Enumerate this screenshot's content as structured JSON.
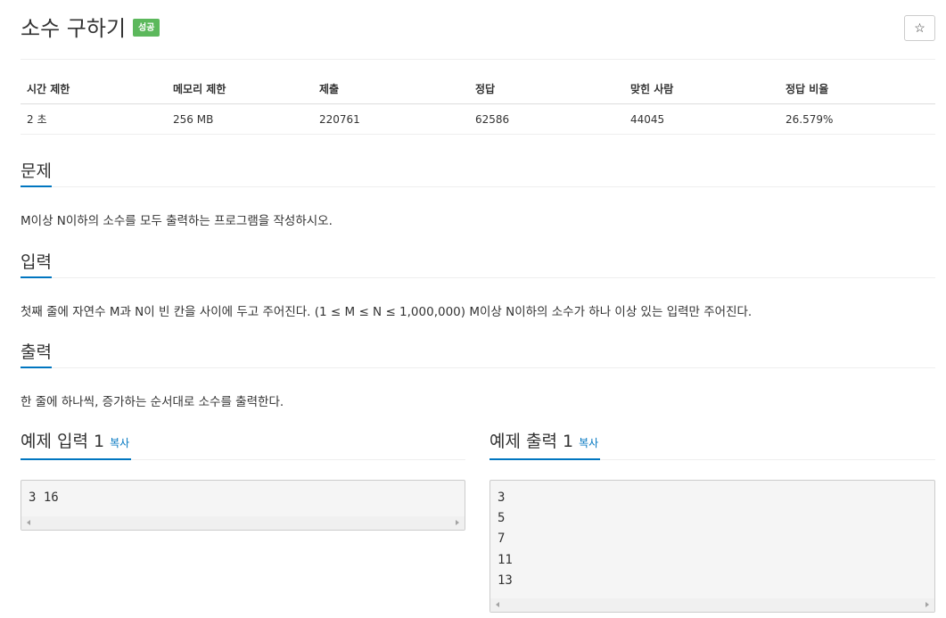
{
  "header": {
    "title": "소수 구하기",
    "badge": "성공",
    "star_icon": "☆"
  },
  "info_table": {
    "headers": [
      "시간 제한",
      "메모리 제한",
      "제출",
      "정답",
      "맞힌 사람",
      "정답 비율"
    ],
    "values": [
      "2 초",
      "256 MB",
      "220761",
      "62586",
      "44045",
      "26.579%"
    ]
  },
  "sections": {
    "problem": {
      "title": "문제",
      "text": "M이상 N이하의 소수를 모두 출력하는 프로그램을 작성하시오."
    },
    "input": {
      "title": "입력",
      "text": "첫째 줄에 자연수 M과 N이 빈 칸을 사이에 두고 주어진다. (1 ≤ M ≤ N ≤ 1,000,000) M이상 N이하의 소수가 하나 이상 있는 입력만 주어진다."
    },
    "output": {
      "title": "출력",
      "text": "한 줄에 하나씩, 증가하는 순서대로 소수를 출력한다."
    }
  },
  "samples": {
    "input": {
      "title": "예제 입력 1",
      "copy_label": "복사",
      "content": "3 16"
    },
    "output": {
      "title": "예제 출력 1",
      "copy_label": "복사",
      "content": "3\n5\n7\n11\n13"
    }
  },
  "colors": {
    "accent": "#0076c0",
    "badge_success": "#5cb85c"
  }
}
